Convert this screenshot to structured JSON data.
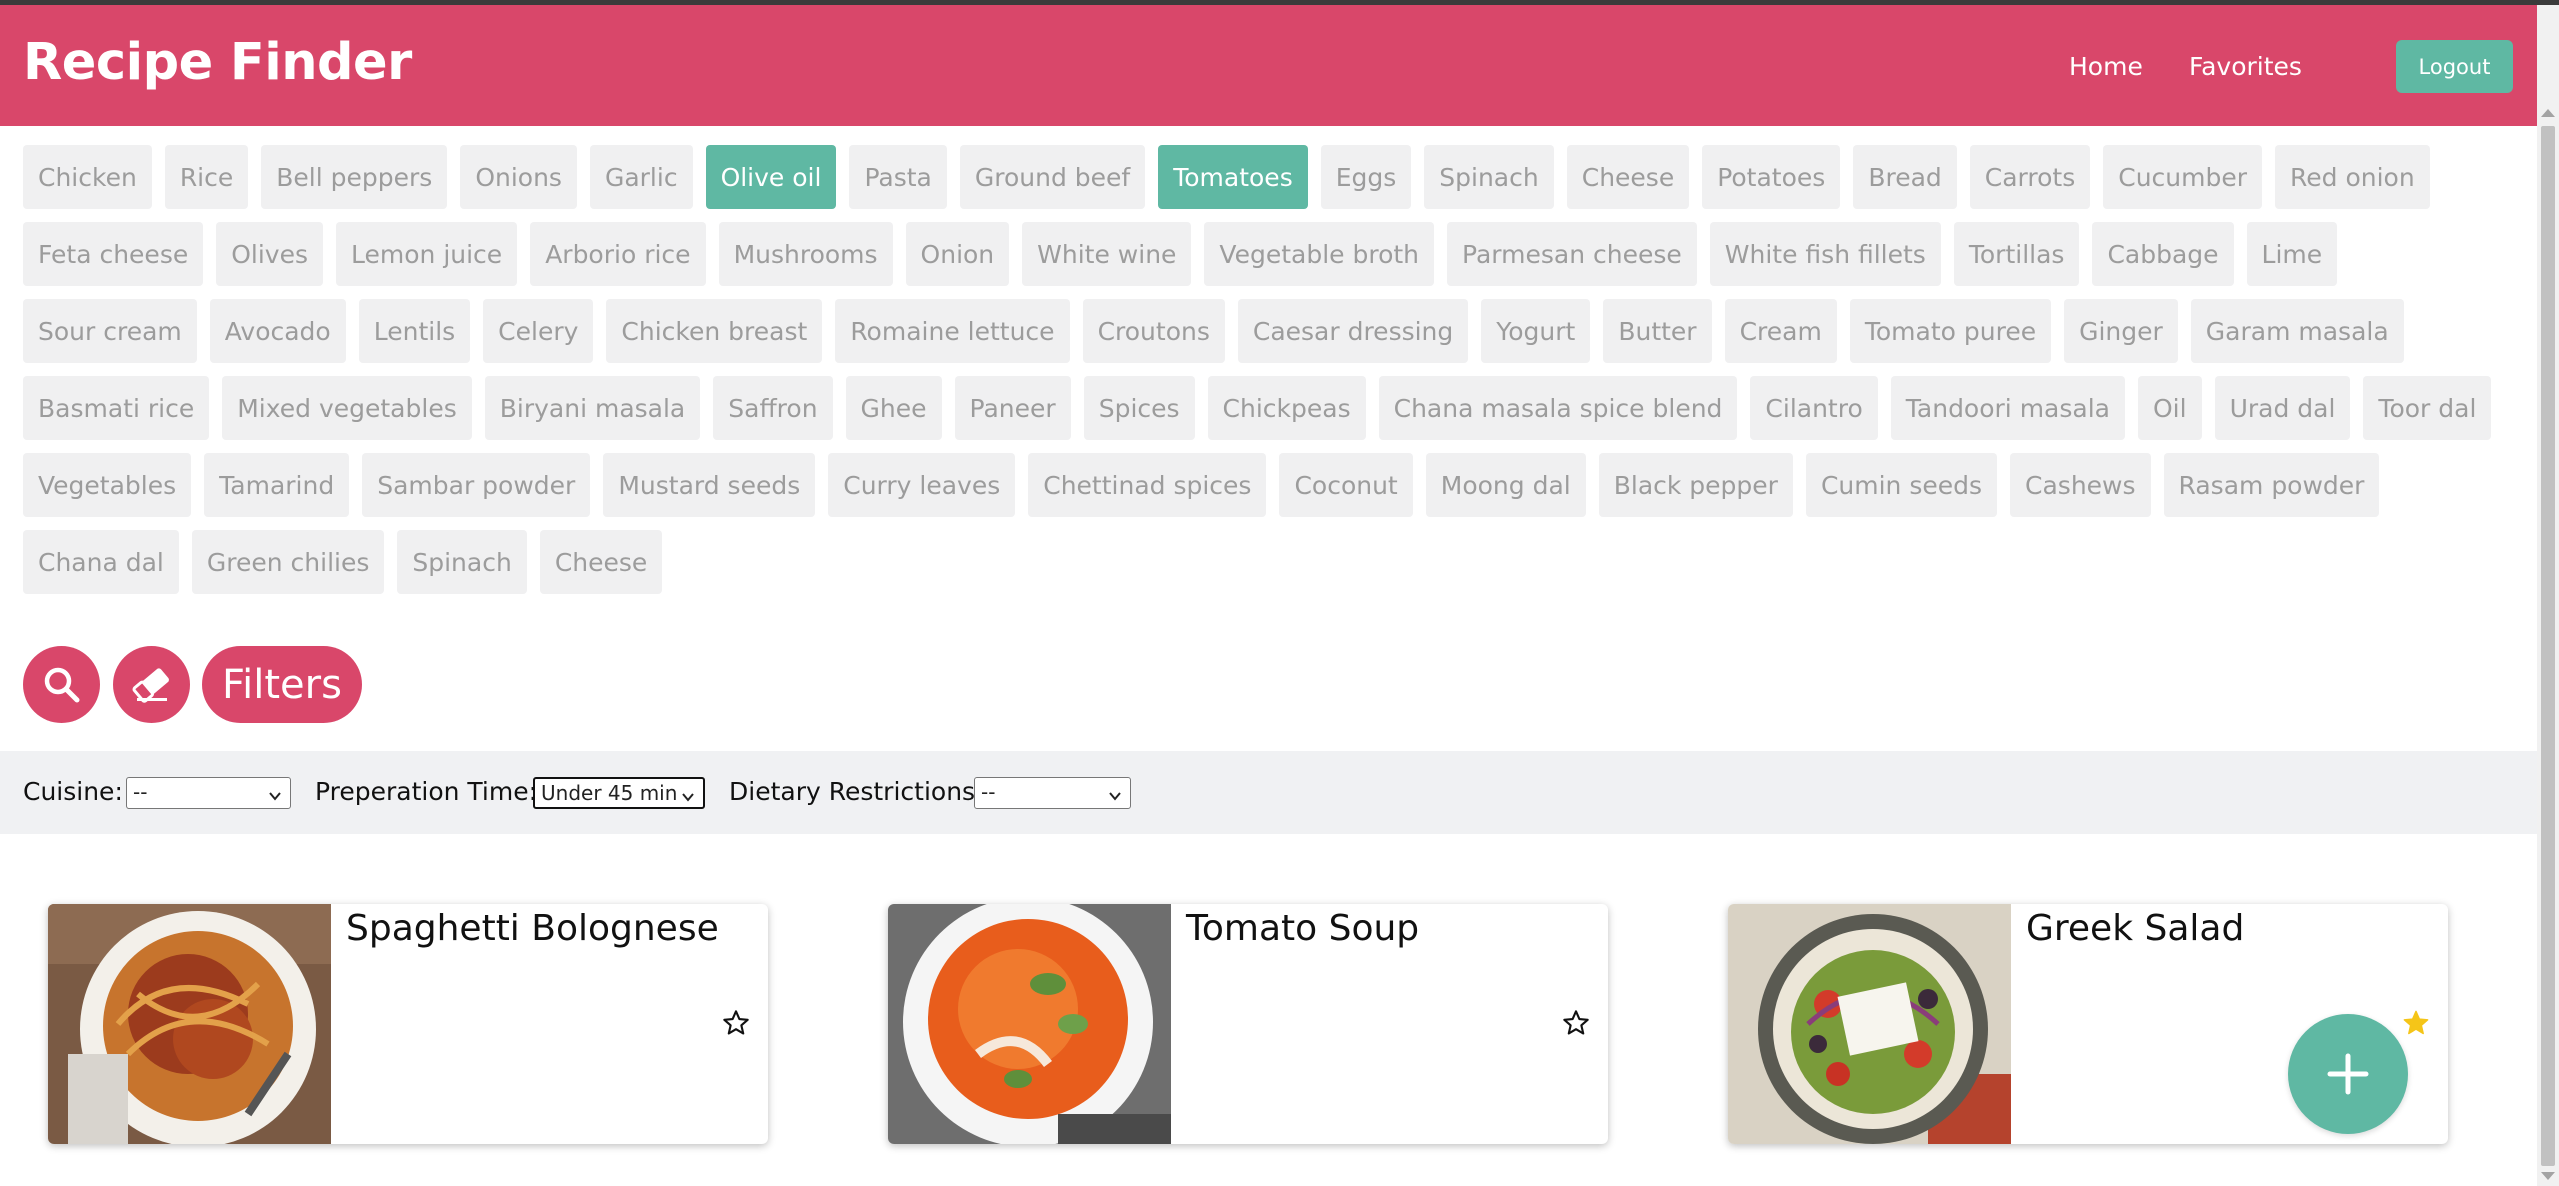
{
  "header": {
    "brand": "Recipe Finder",
    "nav": {
      "home": "Home",
      "favorites": "Favorites"
    },
    "logout": "Logout",
    "brand_color": "#d9476a"
  },
  "ingredients": [
    {
      "label": "Chicken",
      "selected": false
    },
    {
      "label": "Rice",
      "selected": false
    },
    {
      "label": "Bell peppers",
      "selected": false
    },
    {
      "label": "Onions",
      "selected": false
    },
    {
      "label": "Garlic",
      "selected": false
    },
    {
      "label": "Olive oil",
      "selected": true
    },
    {
      "label": "Pasta",
      "selected": false
    },
    {
      "label": "Ground beef",
      "selected": false
    },
    {
      "label": "Tomatoes",
      "selected": true
    },
    {
      "label": "Eggs",
      "selected": false
    },
    {
      "label": "Spinach",
      "selected": false
    },
    {
      "label": "Cheese",
      "selected": false
    },
    {
      "label": "Potatoes",
      "selected": false
    },
    {
      "label": "Bread",
      "selected": false
    },
    {
      "label": "Carrots",
      "selected": false
    },
    {
      "label": "Cucumber",
      "selected": false
    },
    {
      "label": "Red onion",
      "selected": false
    },
    {
      "label": "Feta cheese",
      "selected": false
    },
    {
      "label": "Olives",
      "selected": false
    },
    {
      "label": "Lemon juice",
      "selected": false
    },
    {
      "label": "Arborio rice",
      "selected": false
    },
    {
      "label": "Mushrooms",
      "selected": false
    },
    {
      "label": "Onion",
      "selected": false
    },
    {
      "label": "White wine",
      "selected": false
    },
    {
      "label": "Vegetable broth",
      "selected": false
    },
    {
      "label": "Parmesan cheese",
      "selected": false
    },
    {
      "label": "White fish fillets",
      "selected": false
    },
    {
      "label": "Tortillas",
      "selected": false
    },
    {
      "label": "Cabbage",
      "selected": false
    },
    {
      "label": "Lime",
      "selected": false
    },
    {
      "label": "Sour cream",
      "selected": false
    },
    {
      "label": "Avocado",
      "selected": false
    },
    {
      "label": "Lentils",
      "selected": false
    },
    {
      "label": "Celery",
      "selected": false
    },
    {
      "label": "Chicken breast",
      "selected": false
    },
    {
      "label": "Romaine lettuce",
      "selected": false
    },
    {
      "label": "Croutons",
      "selected": false
    },
    {
      "label": "Caesar dressing",
      "selected": false
    },
    {
      "label": "Yogurt",
      "selected": false
    },
    {
      "label": "Butter",
      "selected": false
    },
    {
      "label": "Cream",
      "selected": false
    },
    {
      "label": "Tomato puree",
      "selected": false
    },
    {
      "label": "Ginger",
      "selected": false
    },
    {
      "label": "Garam masala",
      "selected": false
    },
    {
      "label": "Basmati rice",
      "selected": false
    },
    {
      "label": "Mixed vegetables",
      "selected": false
    },
    {
      "label": "Biryani masala",
      "selected": false
    },
    {
      "label": "Saffron",
      "selected": false
    },
    {
      "label": "Ghee",
      "selected": false
    },
    {
      "label": "Paneer",
      "selected": false
    },
    {
      "label": "Spices",
      "selected": false
    },
    {
      "label": "Chickpeas",
      "selected": false
    },
    {
      "label": "Chana masala spice blend",
      "selected": false
    },
    {
      "label": "Cilantro",
      "selected": false
    },
    {
      "label": "Tandoori masala",
      "selected": false
    },
    {
      "label": "Oil",
      "selected": false
    },
    {
      "label": "Urad dal",
      "selected": false
    },
    {
      "label": "Toor dal",
      "selected": false
    },
    {
      "label": "Vegetables",
      "selected": false
    },
    {
      "label": "Tamarind",
      "selected": false
    },
    {
      "label": "Sambar powder",
      "selected": false
    },
    {
      "label": "Mustard seeds",
      "selected": false
    },
    {
      "label": "Curry leaves",
      "selected": false
    },
    {
      "label": "Chettinad spices",
      "selected": false
    },
    {
      "label": "Coconut",
      "selected": false
    },
    {
      "label": "Moong dal",
      "selected": false
    },
    {
      "label": "Black pepper",
      "selected": false
    },
    {
      "label": "Cumin seeds",
      "selected": false
    },
    {
      "label": "Cashews",
      "selected": false
    },
    {
      "label": "Rasam powder",
      "selected": false
    },
    {
      "label": "Chana dal",
      "selected": false
    },
    {
      "label": "Green chilies",
      "selected": false
    },
    {
      "label": "Spinach",
      "selected": false
    },
    {
      "label": "Cheese",
      "selected": false
    }
  ],
  "actions": {
    "search_icon": "search-icon",
    "clear_icon": "eraser-icon",
    "filters_label": "Filters"
  },
  "filters": {
    "cuisine_label": "Cuisine:",
    "cuisine_value": "--",
    "prep_time_label": "Preperation Time:",
    "prep_time_value": "Under 45 min",
    "dietary_label": "Dietary Restrictions:",
    "dietary_value": "--"
  },
  "recipes": [
    {
      "title": "Spaghetti Bolognese",
      "favorite": false
    },
    {
      "title": "Tomato Soup",
      "favorite": false
    },
    {
      "title": "Greek Salad",
      "favorite": true
    }
  ],
  "fab_icon": "plus-icon",
  "colors": {
    "accent": "#5fb8a3",
    "brand": "#d9476a",
    "star_active": "#f5c518"
  }
}
